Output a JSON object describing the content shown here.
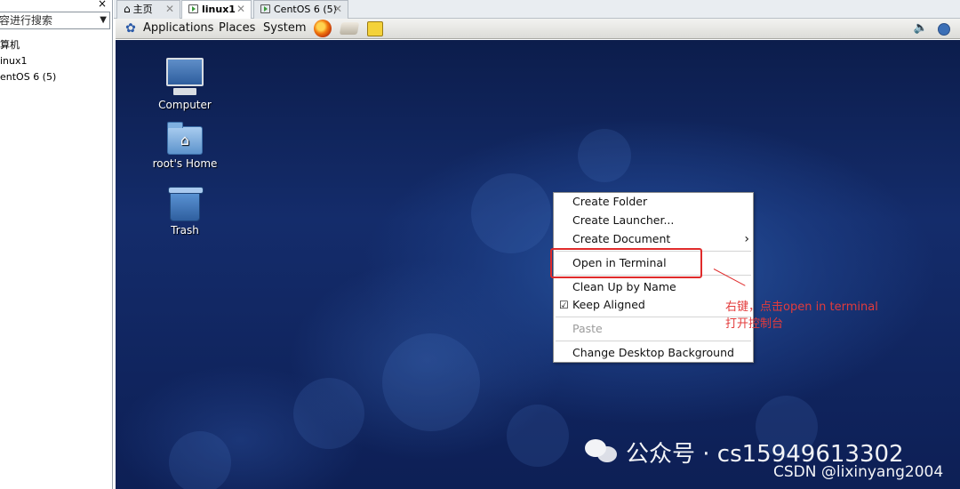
{
  "sidebar": {
    "search_text": "容进行搜索",
    "tree_items": [
      "算机",
      "inux1",
      "entOS 6 (5)"
    ]
  },
  "tabs": [
    {
      "label": "主页"
    },
    {
      "label": "linux1"
    },
    {
      "label": "CentOS 6 (5)"
    }
  ],
  "guest_panel": {
    "menus": [
      "Applications",
      "Places",
      "System"
    ]
  },
  "desktop": {
    "icons": [
      {
        "label": "Computer"
      },
      {
        "label": "root's Home"
      },
      {
        "label": "Trash"
      }
    ],
    "context_menu": {
      "items": [
        {
          "label": "Create Folder"
        },
        {
          "label": "Create Launcher..."
        },
        {
          "label": "Create Document"
        },
        {
          "label": "Open in Terminal"
        },
        {
          "label": "Clean Up by Name"
        },
        {
          "label": "Keep Aligned",
          "checked": true
        },
        {
          "label": "Paste",
          "disabled": true
        },
        {
          "label": "Change Desktop Background"
        }
      ]
    }
  },
  "annotation": {
    "line1": "右键，点击open  in  terminal",
    "line2": "打开控制台",
    "color": "#e33b3b"
  },
  "watermark": {
    "line1": "公众号 · cs15949613302",
    "line2": "CSDN @lixinyang2004"
  }
}
